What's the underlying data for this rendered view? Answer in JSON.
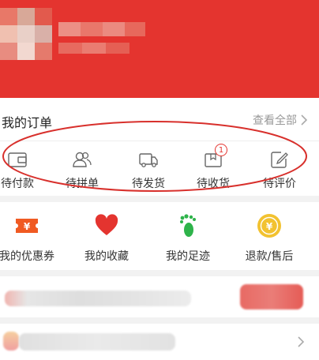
{
  "orders": {
    "title": "我的订单",
    "view_all": "查看全部",
    "items": [
      {
        "label": "待付款",
        "icon": "wallet-icon"
      },
      {
        "label": "待拼单",
        "icon": "group-users-icon"
      },
      {
        "label": "待发货",
        "icon": "truck-icon"
      },
      {
        "label": "待收货",
        "icon": "package-icon",
        "badge": "1"
      },
      {
        "label": "待评价",
        "icon": "edit-review-icon"
      }
    ]
  },
  "services": [
    {
      "label": "我的优惠券",
      "icon": "coupon-icon"
    },
    {
      "label": "我的收藏",
      "icon": "heart-icon"
    },
    {
      "label": "我的足迹",
      "icon": "footprint-icon"
    },
    {
      "label": "退款/售后",
      "icon": "refund-icon"
    }
  ],
  "colors": {
    "brand_red": "#e4342f",
    "coupon_orange": "#f05a22",
    "footprint_green": "#2eb34a",
    "refund_gold": "#f2c230",
    "page_bg": "#f2f2f2"
  }
}
